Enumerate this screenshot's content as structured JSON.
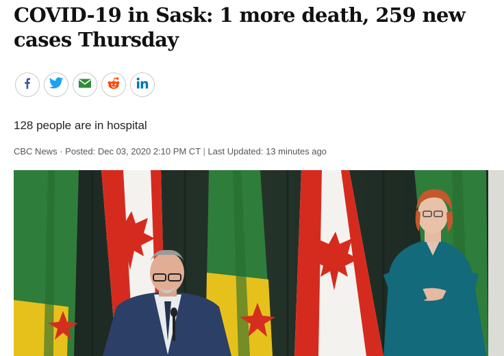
{
  "article": {
    "headline": "COVID-19 in Sask: 1 more death, 259 new cases Thursday",
    "deck": "128 people are in hospital",
    "byline": {
      "source": "CBC News",
      "posted_prefix": "· Posted: Dec 03, 2020 2:10 PM CT",
      "separator": "|",
      "updated": "Last Updated: 13 minutes ago"
    }
  },
  "share": {
    "buttons": [
      {
        "name": "facebook-icon",
        "color": "#3b5998"
      },
      {
        "name": "twitter-icon",
        "color": "#1da1f2"
      },
      {
        "name": "email-icon",
        "color": "#2e8b3a"
      },
      {
        "name": "reddit-icon",
        "color": "#ff4500"
      },
      {
        "name": "linkedin-icon",
        "color": "#0077b5"
      }
    ]
  },
  "colors": {
    "headline": "#111111",
    "canada_red": "#d52b1e",
    "sask_green": "#2f7d3a",
    "sask_yellow": "#e7c11b",
    "curtain": "#1e2a22"
  }
}
